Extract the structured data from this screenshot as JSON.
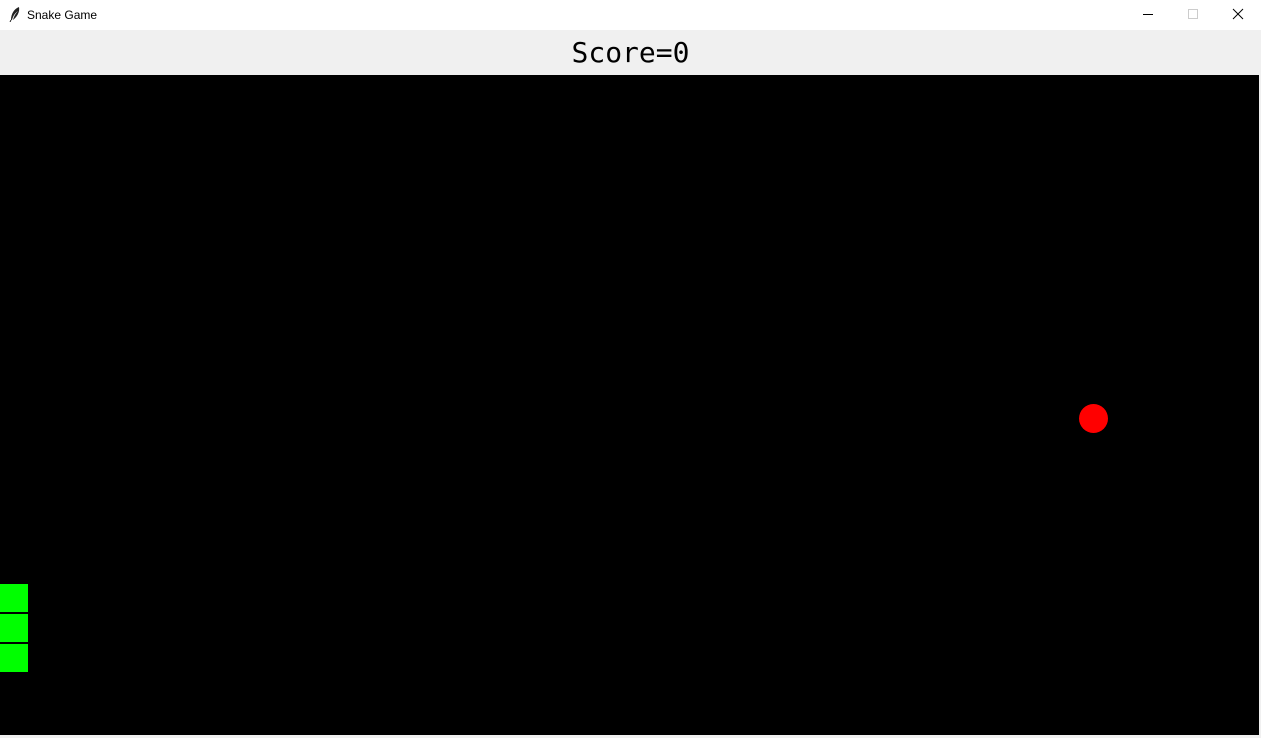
{
  "window": {
    "title": "Snake Game",
    "icon": "feather-icon"
  },
  "header": {
    "score_text": "Score=0"
  },
  "game": {
    "score": 0,
    "snake_segments": 3,
    "colors": {
      "background": "#000000",
      "snake": "#00ff00",
      "food": "#ff0000",
      "header_bg": "#f0f0f0"
    }
  },
  "controls": {
    "minimize_icon": "minimize-icon",
    "maximize_icon": "maximize-icon",
    "close_icon": "close-icon"
  }
}
